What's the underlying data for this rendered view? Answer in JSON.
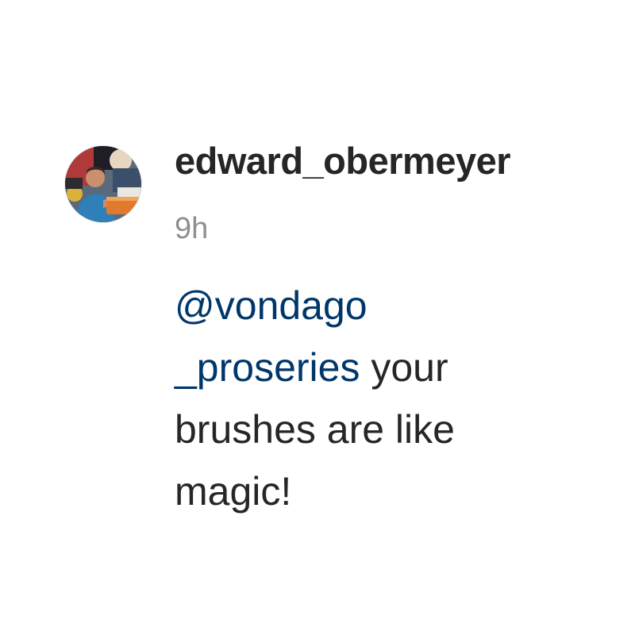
{
  "comment": {
    "username": "edward_obermeyer",
    "timestamp": "9h",
    "avatar_icon": "user-avatar-photo",
    "mention_line1": "@vondago",
    "mention_line2": "_proseries",
    "text_line2_rest": " your",
    "text_line3": "brushes are like",
    "text_line4": "magic!"
  },
  "colors": {
    "text": "#262626",
    "timestamp": "#8e8e8e",
    "mention": "#00376b",
    "background": "#ffffff"
  }
}
